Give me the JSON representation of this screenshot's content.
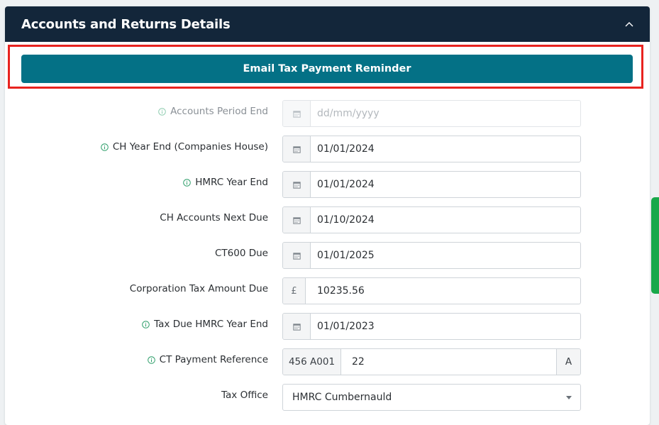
{
  "panel": {
    "title": "Accounts and Returns Details",
    "collapse_icon": "chevron-up-icon"
  },
  "email_button": {
    "label": "Email Tax Payment Reminder",
    "color": "#047186"
  },
  "highlight_color": "#e8231f",
  "fields": {
    "accounts_period_end": {
      "label": "Accounts Period End",
      "placeholder": "dd/mm/yyyy",
      "value": "",
      "icon": "calendar-icon",
      "info": true
    },
    "ch_year_end": {
      "label": "CH Year End (Companies House)",
      "value": "01/01/2024",
      "icon": "calendar-icon",
      "info": true
    },
    "hmrc_year_end": {
      "label": "HMRC Year End",
      "value": "01/01/2024",
      "icon": "calendar-icon",
      "info": true
    },
    "ch_accounts_next_due": {
      "label": "CH Accounts Next Due",
      "value": "01/10/2024",
      "icon": "calendar-icon",
      "info": false
    },
    "ct600_due": {
      "label": "CT600 Due",
      "value": "01/01/2025",
      "icon": "calendar-icon",
      "info": false
    },
    "corporation_tax_amount_due": {
      "label": "Corporation Tax Amount Due",
      "prefix": "£",
      "value": "10235.56",
      "info": false
    },
    "tax_due_hmrc_year_end": {
      "label": "Tax Due HMRC Year End",
      "value": "01/01/2023",
      "icon": "calendar-icon",
      "info": true
    },
    "ct_payment_reference": {
      "label": "CT Payment Reference",
      "prefix": "456 A001",
      "value": "22",
      "suffix": "A",
      "info": true
    },
    "tax_office": {
      "label": "Tax Office",
      "value": "HMRC Cumbernauld",
      "info": false
    }
  },
  "colors": {
    "header_bg": "#13263a",
    "info_icon": "#2e9e6a",
    "side_tab": "#18a84a"
  }
}
